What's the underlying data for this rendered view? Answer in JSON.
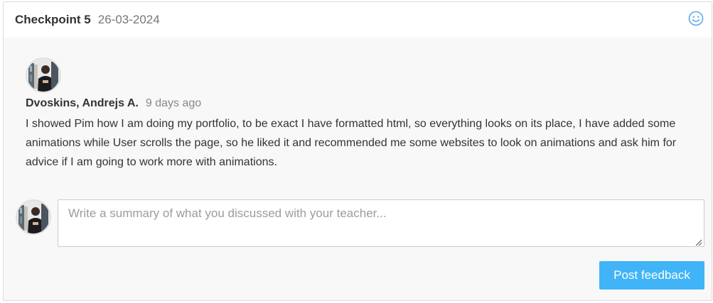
{
  "header": {
    "title": "Checkpoint 5",
    "date": "26-03-2024",
    "icon": "smiley-icon"
  },
  "comment": {
    "author": "Dvoskins, Andrejs A.",
    "time_ago": "9 days ago",
    "text": "I showed Pim how I am doing my portfolio, to be exact I have formatted html, so everything looks on its place, I have added some animations while User scrolls the page, so he liked it and recommended me some websites to look on animations and ask him for advice if I am going to work more with animations."
  },
  "reply": {
    "value": "",
    "placeholder": "Write a summary of what you discussed with your teacher...",
    "submit_label": "Post feedback"
  },
  "colors": {
    "accent": "#40b4f6",
    "panel_bg": "#f8f8f8",
    "header_bg": "#ffffff",
    "smiley": "#5aa8e8"
  }
}
